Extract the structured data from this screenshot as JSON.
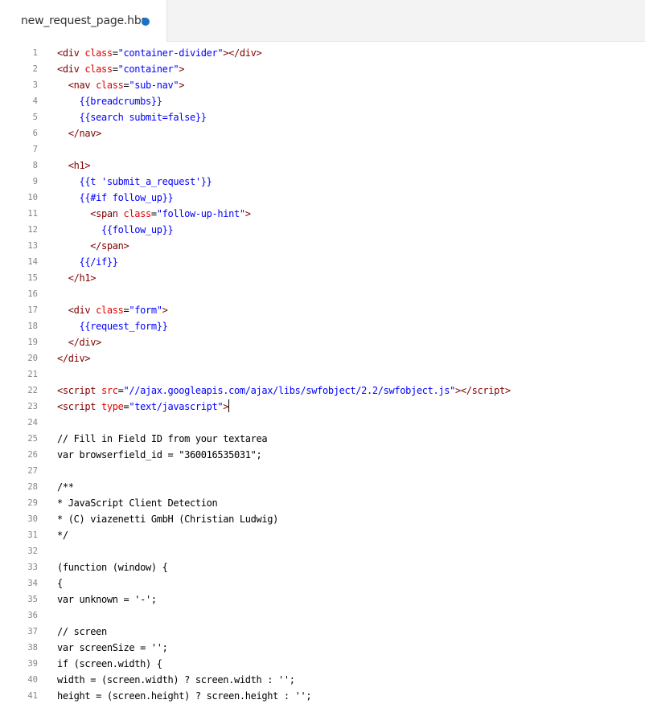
{
  "tab": {
    "filename": "new_request_page.hbs",
    "dirty_indicator_color": "#1a73c7"
  },
  "editor": {
    "cursor_line": 23,
    "lines": [
      {
        "n": "1",
        "tokens": [
          [
            "t-punc",
            "<"
          ],
          [
            "t-tag",
            "div"
          ],
          [
            "t-plain",
            " "
          ],
          [
            "t-attr",
            "class"
          ],
          [
            "t-plain",
            "="
          ],
          [
            "t-str",
            "\"container-divider\""
          ],
          [
            "t-punc",
            "></"
          ],
          [
            "t-tag",
            "div"
          ],
          [
            "t-punc",
            ">"
          ]
        ]
      },
      {
        "n": "2",
        "tokens": [
          [
            "t-punc",
            "<"
          ],
          [
            "t-tag",
            "div"
          ],
          [
            "t-plain",
            " "
          ],
          [
            "t-attr",
            "class"
          ],
          [
            "t-plain",
            "="
          ],
          [
            "t-str",
            "\"container\""
          ],
          [
            "t-punc",
            ">"
          ]
        ]
      },
      {
        "n": "3",
        "tokens": [
          [
            "t-plain",
            "  "
          ],
          [
            "t-punc",
            "<"
          ],
          [
            "t-tag",
            "nav"
          ],
          [
            "t-plain",
            " "
          ],
          [
            "t-attr",
            "class"
          ],
          [
            "t-plain",
            "="
          ],
          [
            "t-str",
            "\"sub-nav\""
          ],
          [
            "t-punc",
            ">"
          ]
        ]
      },
      {
        "n": "4",
        "tokens": [
          [
            "t-plain",
            "    "
          ],
          [
            "t-hbs",
            "{{breadcrumbs}}"
          ]
        ]
      },
      {
        "n": "5",
        "tokens": [
          [
            "t-plain",
            "    "
          ],
          [
            "t-hbs",
            "{{search submit=false}}"
          ]
        ]
      },
      {
        "n": "6",
        "tokens": [
          [
            "t-plain",
            "  "
          ],
          [
            "t-punc",
            "</"
          ],
          [
            "t-tag",
            "nav"
          ],
          [
            "t-punc",
            ">"
          ]
        ]
      },
      {
        "n": "7",
        "tokens": []
      },
      {
        "n": "8",
        "tokens": [
          [
            "t-plain",
            "  "
          ],
          [
            "t-punc",
            "<"
          ],
          [
            "t-tag",
            "h1"
          ],
          [
            "t-punc",
            ">"
          ]
        ]
      },
      {
        "n": "9",
        "tokens": [
          [
            "t-plain",
            "    "
          ],
          [
            "t-hbs",
            "{{t "
          ],
          [
            "t-str",
            "'submit_a_request'"
          ],
          [
            "t-hbs",
            "}}"
          ]
        ]
      },
      {
        "n": "10",
        "tokens": [
          [
            "t-plain",
            "    "
          ],
          [
            "t-hbs",
            "{{#if follow_up}}"
          ]
        ]
      },
      {
        "n": "11",
        "tokens": [
          [
            "t-plain",
            "      "
          ],
          [
            "t-punc",
            "<"
          ],
          [
            "t-tag",
            "span"
          ],
          [
            "t-plain",
            " "
          ],
          [
            "t-attr",
            "class"
          ],
          [
            "t-plain",
            "="
          ],
          [
            "t-str",
            "\"follow-up-hint\""
          ],
          [
            "t-punc",
            ">"
          ]
        ]
      },
      {
        "n": "12",
        "tokens": [
          [
            "t-plain",
            "        "
          ],
          [
            "t-hbs",
            "{{follow_up}}"
          ]
        ]
      },
      {
        "n": "13",
        "tokens": [
          [
            "t-plain",
            "      "
          ],
          [
            "t-punc",
            "</"
          ],
          [
            "t-tag",
            "span"
          ],
          [
            "t-punc",
            ">"
          ]
        ]
      },
      {
        "n": "14",
        "tokens": [
          [
            "t-plain",
            "    "
          ],
          [
            "t-hbs",
            "{{/if}}"
          ]
        ]
      },
      {
        "n": "15",
        "tokens": [
          [
            "t-plain",
            "  "
          ],
          [
            "t-punc",
            "</"
          ],
          [
            "t-tag",
            "h1"
          ],
          [
            "t-punc",
            ">"
          ]
        ]
      },
      {
        "n": "16",
        "tokens": []
      },
      {
        "n": "17",
        "tokens": [
          [
            "t-plain",
            "  "
          ],
          [
            "t-punc",
            "<"
          ],
          [
            "t-tag",
            "div"
          ],
          [
            "t-plain",
            " "
          ],
          [
            "t-attr",
            "class"
          ],
          [
            "t-plain",
            "="
          ],
          [
            "t-str",
            "\"form\""
          ],
          [
            "t-punc",
            ">"
          ]
        ]
      },
      {
        "n": "18",
        "tokens": [
          [
            "t-plain",
            "    "
          ],
          [
            "t-hbs",
            "{{request_form}}"
          ]
        ]
      },
      {
        "n": "19",
        "tokens": [
          [
            "t-plain",
            "  "
          ],
          [
            "t-punc",
            "</"
          ],
          [
            "t-tag",
            "div"
          ],
          [
            "t-punc",
            ">"
          ]
        ]
      },
      {
        "n": "20",
        "tokens": [
          [
            "t-punc",
            "</"
          ],
          [
            "t-tag",
            "div"
          ],
          [
            "t-punc",
            ">"
          ]
        ]
      },
      {
        "n": "21",
        "tokens": []
      },
      {
        "n": "22",
        "tokens": [
          [
            "t-punc",
            "<"
          ],
          [
            "t-tag",
            "script"
          ],
          [
            "t-plain",
            " "
          ],
          [
            "t-attr",
            "src"
          ],
          [
            "t-plain",
            "="
          ],
          [
            "t-str",
            "\"//ajax.googleapis.com/ajax/libs/swfobject/2.2/swfobject.js\""
          ],
          [
            "t-punc",
            "></"
          ],
          [
            "t-tag",
            "script"
          ],
          [
            "t-punc",
            ">"
          ]
        ]
      },
      {
        "n": "23",
        "tokens": [
          [
            "t-punc",
            "<"
          ],
          [
            "t-tag",
            "script"
          ],
          [
            "t-plain",
            " "
          ],
          [
            "t-attr",
            "type"
          ],
          [
            "t-plain",
            "="
          ],
          [
            "t-str",
            "\"text/javascript\""
          ],
          [
            "t-punc",
            ">"
          ]
        ]
      },
      {
        "n": "24",
        "tokens": []
      },
      {
        "n": "25",
        "tokens": [
          [
            "t-plain",
            "// Fill in Field ID from your textarea"
          ]
        ]
      },
      {
        "n": "26",
        "tokens": [
          [
            "t-plain",
            "var browserfield_id = \"360016535031\";"
          ]
        ]
      },
      {
        "n": "27",
        "tokens": []
      },
      {
        "n": "28",
        "tokens": [
          [
            "t-plain",
            "/**"
          ]
        ]
      },
      {
        "n": "29",
        "tokens": [
          [
            "t-plain",
            "* JavaScript Client Detection"
          ]
        ]
      },
      {
        "n": "30",
        "tokens": [
          [
            "t-plain",
            "* (C) viazenetti GmbH (Christian Ludwig)"
          ]
        ]
      },
      {
        "n": "31",
        "tokens": [
          [
            "t-plain",
            "*/"
          ]
        ]
      },
      {
        "n": "32",
        "tokens": []
      },
      {
        "n": "33",
        "tokens": [
          [
            "t-plain",
            "(function (window) {"
          ]
        ]
      },
      {
        "n": "34",
        "tokens": [
          [
            "t-plain",
            "{"
          ]
        ]
      },
      {
        "n": "35",
        "tokens": [
          [
            "t-plain",
            "var unknown = '-';"
          ]
        ]
      },
      {
        "n": "36",
        "tokens": []
      },
      {
        "n": "37",
        "tokens": [
          [
            "t-plain",
            "// screen"
          ]
        ]
      },
      {
        "n": "38",
        "tokens": [
          [
            "t-plain",
            "var screenSize = '';"
          ]
        ]
      },
      {
        "n": "39",
        "tokens": [
          [
            "t-plain",
            "if (screen.width) {"
          ]
        ]
      },
      {
        "n": "40",
        "tokens": [
          [
            "t-plain",
            "width = (screen.width) ? screen.width : '';"
          ]
        ]
      },
      {
        "n": "41",
        "tokens": [
          [
            "t-plain",
            "height = (screen.height) ? screen.height : '';"
          ]
        ]
      }
    ]
  }
}
